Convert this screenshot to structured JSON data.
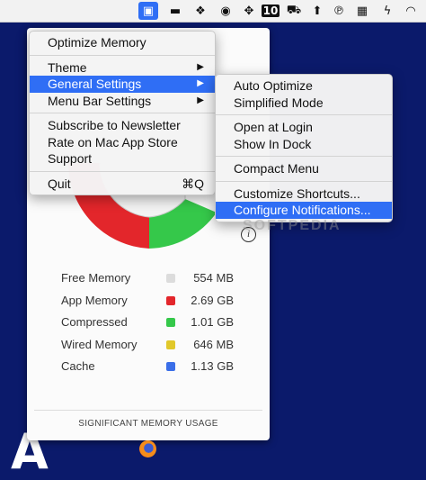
{
  "menubar": {
    "icons": [
      "chip-icon",
      "terminal-icon",
      "dropbox-icon",
      "circle-logo-icon",
      "crosshair-icon",
      "calendar-icon",
      "car-icon",
      "upload-arrow-icon",
      "parking-icon",
      "film-icon",
      "flash-icon",
      "wifi-icon"
    ],
    "badge_text": "10"
  },
  "main_menu": {
    "items": [
      {
        "label": "Optimize Memory"
      },
      {
        "label": "Theme"
      },
      {
        "label": "General Settings"
      },
      {
        "label": "Menu Bar Settings"
      },
      {
        "label": "Subscribe to Newsletter"
      },
      {
        "label": "Rate on Mac App Store"
      },
      {
        "label": "Support"
      },
      {
        "label": "Quit",
        "shortcut": "⌘Q"
      }
    ]
  },
  "submenu": {
    "items": [
      {
        "label": "Auto Optimize"
      },
      {
        "label": "Simplified Mode"
      },
      {
        "label": "Open at Login"
      },
      {
        "label": "Show In Dock"
      },
      {
        "label": "Compact Menu"
      },
      {
        "label": "Customize Shortcuts..."
      },
      {
        "label": "Configure Notifications..."
      }
    ]
  },
  "panel": {
    "legend": [
      {
        "label": "Free Memory",
        "value": "554 MB",
        "color": "#dcdcdc"
      },
      {
        "label": "App Memory",
        "value": "2.69 GB",
        "color": "#e3262b"
      },
      {
        "label": "Compressed",
        "value": "1.01 GB",
        "color": "#35c84a"
      },
      {
        "label": "Wired Memory",
        "value": "646 MB",
        "color": "#e1c82a"
      },
      {
        "label": "Cache",
        "value": "1.13 GB",
        "color": "#3a6ee8"
      }
    ],
    "significant_label": "SIGNIFICANT MEMORY USAGE"
  },
  "watermark": "SOFTPEDIA"
}
